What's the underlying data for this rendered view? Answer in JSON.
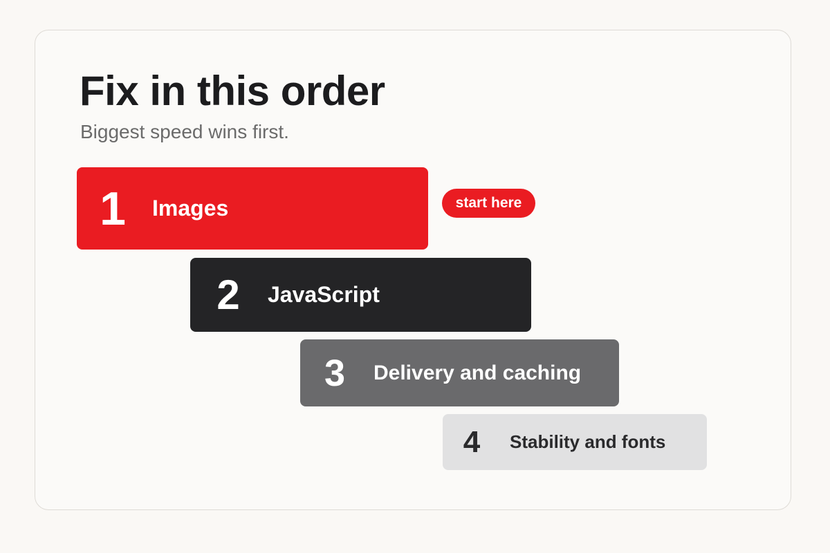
{
  "title": "Fix in this order",
  "subtitle": "Biggest speed wins first.",
  "steps": [
    {
      "number": "1",
      "label": "Images"
    },
    {
      "number": "2",
      "label": "JavaScript"
    },
    {
      "number": "3",
      "label": "Delivery and caching"
    },
    {
      "number": "4",
      "label": "Stability and fonts"
    }
  ],
  "badge": "start here",
  "colors": {
    "accent": "#ea1c22",
    "step_2": "#242426",
    "step_3": "#6a6a6c",
    "step_4": "#e1e1e2",
    "title": "#1c1c1e",
    "subtitle": "#6b6b6b",
    "background": "#faf8f5"
  }
}
